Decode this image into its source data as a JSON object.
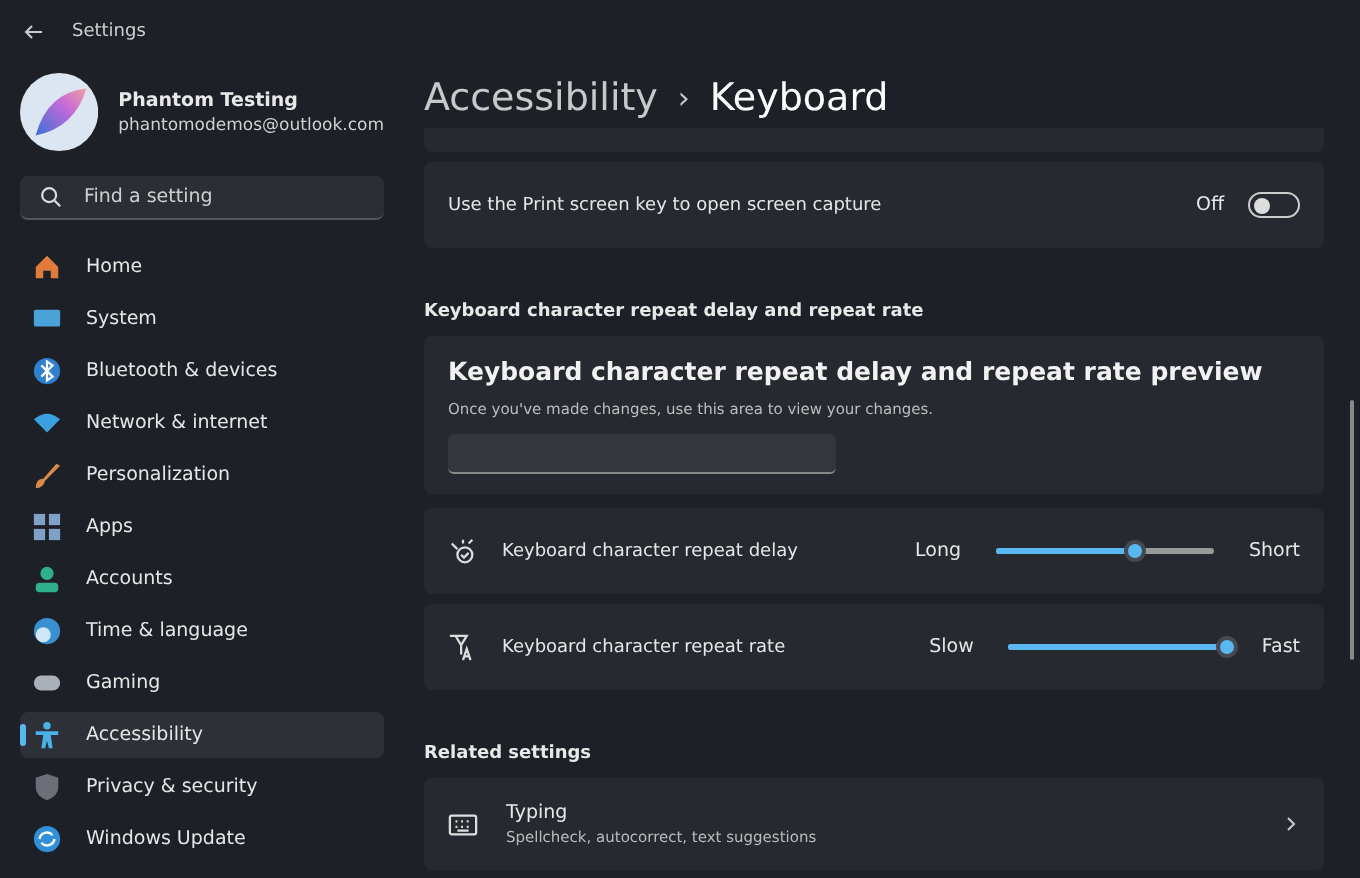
{
  "window": {
    "title": "Settings"
  },
  "account": {
    "name": "Phantom Testing",
    "email": "phantomodemos@outlook.com"
  },
  "search": {
    "placeholder": "Find a setting"
  },
  "nav": [
    {
      "label": "Home",
      "selected": false
    },
    {
      "label": "System",
      "selected": false
    },
    {
      "label": "Bluetooth & devices",
      "selected": false
    },
    {
      "label": "Network & internet",
      "selected": false
    },
    {
      "label": "Personalization",
      "selected": false
    },
    {
      "label": "Apps",
      "selected": false
    },
    {
      "label": "Accounts",
      "selected": false
    },
    {
      "label": "Time & language",
      "selected": false
    },
    {
      "label": "Gaming",
      "selected": false
    },
    {
      "label": "Accessibility",
      "selected": true
    },
    {
      "label": "Privacy & security",
      "selected": false
    },
    {
      "label": "Windows Update",
      "selected": false
    }
  ],
  "breadcrumb": {
    "parent": "Accessibility",
    "separator": "›",
    "current": "Keyboard"
  },
  "print_screen": {
    "label": "Use the Print screen key to open screen capture",
    "state": "Off",
    "on": false
  },
  "section": "Keyboard character repeat delay and repeat rate",
  "preview": {
    "title": "Keyboard character repeat delay and repeat rate preview",
    "hint": "Once you've made changes, use this area to view your changes."
  },
  "sliders": [
    {
      "label": "Keyboard character repeat delay",
      "min_label": "Long",
      "max_label": "Short",
      "level": 0.64
    },
    {
      "label": "Keyboard character repeat rate",
      "min_label": "Slow",
      "max_label": "Fast",
      "level": 1
    }
  ],
  "related": {
    "heading": "Related settings",
    "items": [
      {
        "title": "Typing",
        "subtitle": "Spellcheck, autocorrect, text suggestions"
      }
    ]
  }
}
